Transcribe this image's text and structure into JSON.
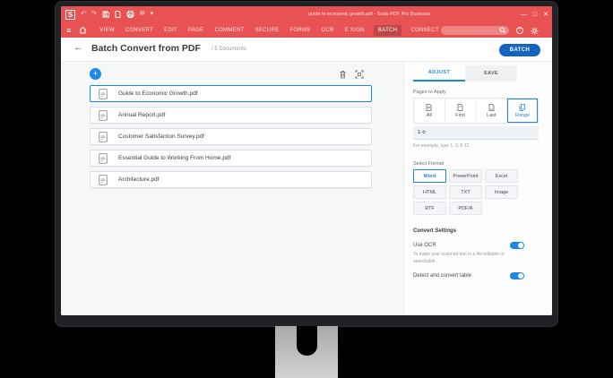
{
  "window": {
    "logo": "S",
    "title": "guide to economic growth.pdf  -  Soda PDF Pro Business",
    "controls": {
      "minimize": "—",
      "maximize": "□",
      "close": "✕"
    }
  },
  "titlebar_icons": {
    "undo": "↶",
    "redo": "↷",
    "email": "✉",
    "chevron": "▾"
  },
  "menubar": {
    "hamburger": "≡",
    "items": [
      {
        "label": "VIEW",
        "active": false
      },
      {
        "label": "CONVERT",
        "active": false
      },
      {
        "label": "EDIT",
        "active": false
      },
      {
        "label": "PAGE",
        "active": false
      },
      {
        "label": "COMMENT",
        "active": false
      },
      {
        "label": "SECURE",
        "active": false
      },
      {
        "label": "FORMS",
        "active": false
      },
      {
        "label": "OCR",
        "active": false
      },
      {
        "label": "E SIGN",
        "active": false
      },
      {
        "label": "BATCH",
        "active": true
      },
      {
        "label": "CONNECT",
        "active": false
      }
    ],
    "help_glyph": "?"
  },
  "header": {
    "back_arrow": "←",
    "title": "Batch Convert from PDF",
    "subtitle": "/ 5 Documents",
    "batch_button": "BATCH"
  },
  "file_toolbar": {
    "add": "+"
  },
  "file_list": {
    "items": [
      {
        "name": "Guide to Economic Growth.pdf",
        "selected": true
      },
      {
        "name": "Annual Report.pdf",
        "selected": false
      },
      {
        "name": "Customer Satisfaction Survey.pdf",
        "selected": false
      },
      {
        "name": "Essential Guide to Working From Home.pdf",
        "selected": false
      },
      {
        "name": "Architecture.pdf",
        "selected": false
      }
    ]
  },
  "panel": {
    "tabs": [
      {
        "label": "ADJUST",
        "active": true
      },
      {
        "label": "SAVE",
        "active": false
      }
    ],
    "pages_to_apply": {
      "label": "Pages to Apply",
      "options": [
        {
          "label": "All",
          "selected": false
        },
        {
          "label": "First",
          "selected": false
        },
        {
          "label": "Last",
          "selected": false
        },
        {
          "label": "Range",
          "selected": true
        }
      ],
      "range_value": "1-5",
      "helper": "For example, type 1, 3, 5-12"
    },
    "select_format": {
      "label": "Select Format",
      "options": [
        {
          "label": "Word",
          "selected": true
        },
        {
          "label": "PowerPoint",
          "selected": false
        },
        {
          "label": "Excel",
          "selected": false
        },
        {
          "label": "HTML",
          "selected": false
        },
        {
          "label": "TXT",
          "selected": false
        },
        {
          "label": "Image",
          "selected": false
        },
        {
          "label": "RTF",
          "selected": false
        },
        {
          "label": "PDF/A",
          "selected": false
        }
      ]
    },
    "convert_settings": {
      "label": "Convert Settings",
      "use_ocr": {
        "label": "Use OCR",
        "on": true,
        "description": "To make your scanned text in a file editable or searchable"
      },
      "detect_table": {
        "label": "Detect and convert table",
        "on": true
      }
    }
  },
  "colors": {
    "brand_red": "#e85252",
    "accent_blue": "#1e88e5",
    "button_blue": "#1565c0"
  }
}
